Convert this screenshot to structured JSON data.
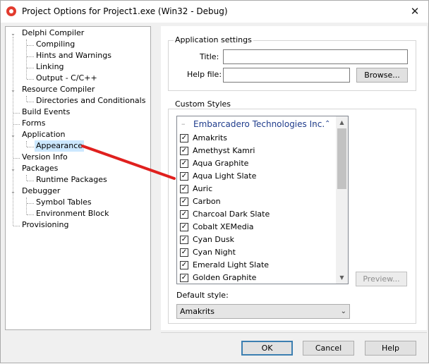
{
  "window": {
    "title": "Project Options for Project1.exe  (Win32 - Debug)",
    "close_glyph": "✕"
  },
  "tree": {
    "items": [
      {
        "label": "Delphi Compiler",
        "expander": "⌄"
      },
      {
        "label": "Compiling"
      },
      {
        "label": "Hints and Warnings"
      },
      {
        "label": "Linking"
      },
      {
        "label": "Output - C/C++"
      },
      {
        "label": "Resource Compiler",
        "expander": "⌄"
      },
      {
        "label": "Directories and Conditionals"
      },
      {
        "label": "Build Events"
      },
      {
        "label": "Forms"
      },
      {
        "label": "Application",
        "expander": "⌄"
      },
      {
        "label": "Appearance",
        "selected": true
      },
      {
        "label": "Version Info"
      },
      {
        "label": "Packages",
        "expander": "⌄"
      },
      {
        "label": "Runtime Packages"
      },
      {
        "label": "Debugger",
        "expander": "⌄"
      },
      {
        "label": "Symbol Tables"
      },
      {
        "label": "Environment Block"
      },
      {
        "label": "Provisioning"
      }
    ]
  },
  "application_settings": {
    "group_label": "Application settings",
    "title_label": "Title:",
    "title_value": "",
    "help_file_label": "Help file:",
    "help_file_value": "",
    "browse_label": "Browse..."
  },
  "custom_styles": {
    "group_label": "Custom Styles",
    "header": "Embarcadero Technologies Inc.",
    "header_caret": "⌃",
    "checkmark": "✓",
    "items": [
      "Amakrits",
      "Amethyst Kamri",
      "Aqua Graphite",
      "Aqua Light Slate",
      "Auric",
      "Carbon",
      "Charcoal Dark Slate",
      "Cobalt XEMedia",
      "Cyan Dusk",
      "Cyan Night",
      "Emerald Light Slate",
      "Golden Graphite"
    ],
    "preview_label": "Preview...",
    "default_style_label": "Default style:",
    "default_style_value": "Amakrits"
  },
  "buttons": {
    "ok": "OK",
    "cancel": "Cancel",
    "help": "Help"
  },
  "annotation": {
    "arrow_color": "#e0201e"
  }
}
